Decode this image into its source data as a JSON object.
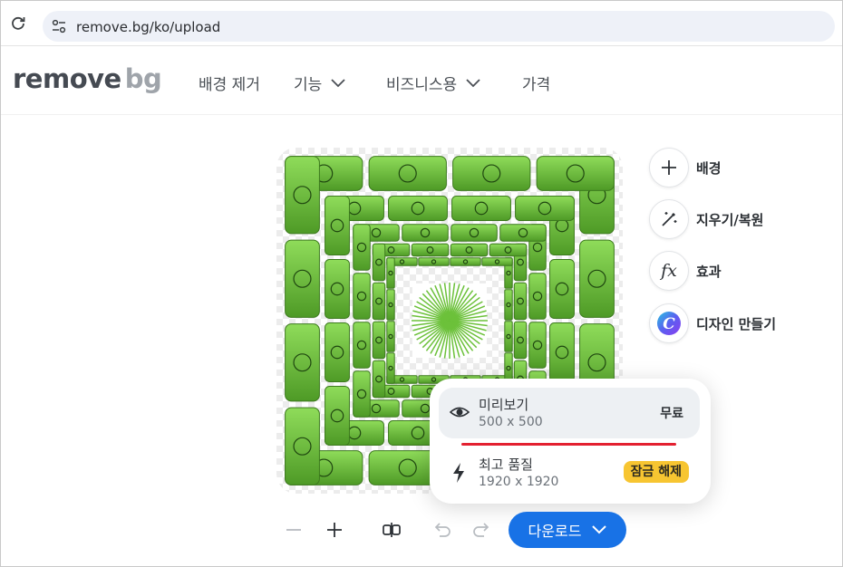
{
  "browser": {
    "url": "remove.bg/ko/upload"
  },
  "nav": {
    "logo_main": "remove",
    "logo_bg": "bg",
    "items": [
      {
        "label": "배경 제거"
      },
      {
        "label": "기능"
      },
      {
        "label": "비즈니스용"
      },
      {
        "label": "가격"
      }
    ]
  },
  "tools": [
    {
      "label": "배경",
      "icon": "plus-icon"
    },
    {
      "label": "지우기/복원",
      "icon": "magic-wand-icon"
    },
    {
      "label": "효과",
      "icon": "fx-icon"
    },
    {
      "label": "디자인 만들기",
      "icon": "canva-icon"
    }
  ],
  "download_menu": {
    "preview": {
      "title": "미리보기",
      "size": "500 x 500",
      "badge": "무료",
      "icon": "eye-icon"
    },
    "hq": {
      "title": "최고 품질",
      "size": "1920 x 1920",
      "badge": "잠금 해제",
      "icon": "bolt-icon"
    }
  },
  "toolbar": {
    "download_label": "다운로드"
  },
  "colors": {
    "accent": "#1872e6",
    "tile_green": "#6cc13a",
    "unlock_badge": "#f7c531",
    "red_line": "#e32030"
  }
}
